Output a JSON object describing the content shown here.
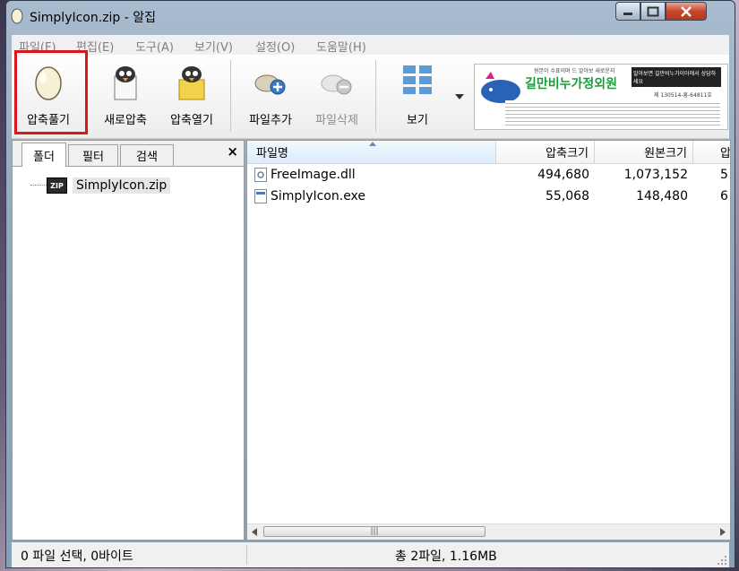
{
  "window": {
    "title": "SimplyIcon.zip - 알집"
  },
  "menu": [
    "파일(F)",
    "편집(E)",
    "도구(A)",
    "보기(V)",
    "설정(O)",
    "도움말(H)"
  ],
  "toolbar": {
    "extract": "압축풀기",
    "new_archive": "새로압축",
    "open_archive": "압축열기",
    "add_files": "파일추가",
    "delete_files": "파일삭제",
    "view": "보기"
  },
  "ad": {
    "top_line": "원본이 수표이며 드 알아보 새로운지",
    "side_line": "알아보면 길만비누가이아에서 상담하세요",
    "brand": "길만비누가정외원",
    "reg": "제 130514-흥-64811호"
  },
  "left_pane": {
    "tabs": [
      "폴더",
      "필터",
      "검색"
    ],
    "close": "×",
    "tree_icon_text": "ZIP",
    "tree_item": "SimplyIcon.zip"
  },
  "file_list": {
    "columns": [
      "파일명",
      "압축크기",
      "원본크기",
      "압축"
    ],
    "rows": [
      {
        "name": "FreeImage.dll",
        "compressed": "494,680",
        "original": "1,073,152",
        "ratio": "5"
      },
      {
        "name": "SimplyIcon.exe",
        "compressed": "55,068",
        "original": "148,480",
        "ratio": "6"
      }
    ],
    "scroll_thumb": "|||"
  },
  "status": {
    "selection": "0 파일 선택,  0바이트",
    "total": "총 2파일,  1.16MB"
  }
}
